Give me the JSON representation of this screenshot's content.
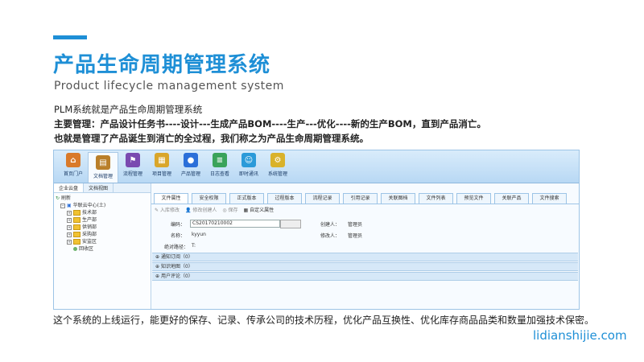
{
  "slide": {
    "title": "产品生命周期管理系统",
    "subtitle": "Product lifecycle management system",
    "line1": "PLM系统就是产品生命周期管理系统",
    "line2": "主要管理：产品设计任务书----设计---生成产品BOM----生产---优化----新的生产BOM，直到产品消亡。",
    "line3": "也就是管理了产品诞生到消亡的全过程，我们称之为产品生命周期管理系统。",
    "outro": "这个系统的上线运行，能更好的保存、记录、传承公司的技术历程，优化产品互换性、优化库存商品品类和数量加强技术保密。",
    "site": "lidianshijie.com",
    "accent_color": "#1e8fd6"
  },
  "app": {
    "toolbar": [
      {
        "label": "首页门户",
        "icon": "home-icon",
        "color": "#d97a2b"
      },
      {
        "label": "文档管理",
        "icon": "document-icon",
        "color": "#b97f2a"
      },
      {
        "label": "流程管理",
        "icon": "flow-icon",
        "color": "#7a4ab0"
      },
      {
        "label": "项目管理",
        "icon": "project-icon",
        "color": "#d9a62b"
      },
      {
        "label": "产品管理",
        "icon": "product-icon",
        "color": "#2b6fd9"
      },
      {
        "label": "日志查看",
        "icon": "log-icon",
        "color": "#3aa35a"
      },
      {
        "label": "即时通讯",
        "icon": "chat-icon",
        "color": "#2b9ad9"
      },
      {
        "label": "系统管理",
        "icon": "settings-icon",
        "color": "#d9b22b"
      }
    ],
    "side_tabs": [
      "企业云盘",
      "文档视图"
    ],
    "tree": {
      "refresh": "刷新",
      "root": "华联云中心(土)",
      "nodes": [
        "技术部",
        "生产部",
        "供销部",
        "采购部",
        "安监区"
      ],
      "leaf": "回收区"
    },
    "tabs": [
      "文件属性",
      "安全权限",
      "正式版本",
      "过程版本",
      "流程记录",
      "引用记录",
      "关联图档",
      "文件列表",
      "预览文件",
      "关联产品",
      "文件搜索"
    ],
    "actions": [
      "入库修改",
      "修改创建人",
      "保存",
      "自定义属性"
    ],
    "form": {
      "code_label": "编码：",
      "code_value": "CS20170210002",
      "name_label": "名称：",
      "name_value": "kyyun",
      "path_label": "绝对路径：",
      "path_value": "T:",
      "creator_label": "创建人：",
      "creator_value": "管理员",
      "modifier_label": "修改人：",
      "modifier_value": "管理员"
    },
    "sections": [
      "通知订阅（0）",
      "知识地图（0）",
      "用户评论（0）"
    ]
  }
}
